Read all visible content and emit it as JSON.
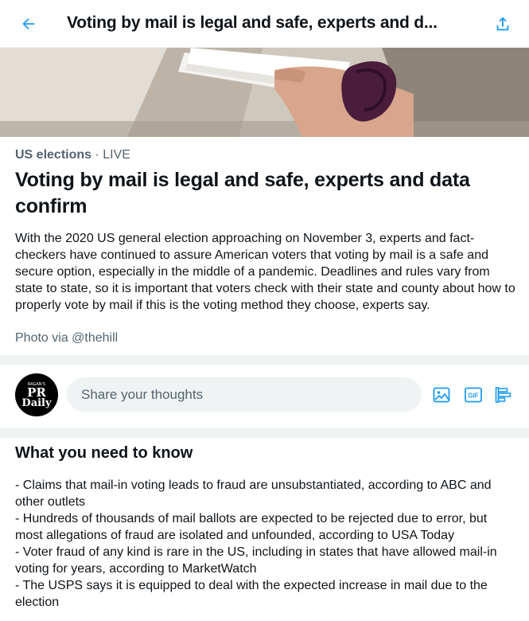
{
  "header": {
    "title": "Voting by mail is legal and safe, experts and d...",
    "back_icon": "arrow-left-icon",
    "share_icon": "share-icon",
    "accent_color": "#1d9bf0"
  },
  "hero": {
    "description": "hand holding mail envelopes"
  },
  "story": {
    "topic": "US elections",
    "separator": "·",
    "status": "LIVE",
    "headline": "Voting by mail is legal and safe, experts and data confirm",
    "summary": "With the 2020 US general election approaching on November 3, experts and fact-checkers have continued to assure American voters that voting by mail is a safe and secure option, especially in the middle of a pandemic. Deadlines and rules vary from state to state, so it is important that voters check with their state and county about how to properly vote by mail if this is the voting method they choose, experts say.",
    "photo_credit": "Photo via @thehill"
  },
  "composer": {
    "avatar": {
      "small_text": "RAGAN'S",
      "line1": "PR",
      "line2": "Daily"
    },
    "placeholder": "Share your thoughts",
    "tools": [
      "image-icon",
      "gif-icon",
      "poll-icon"
    ]
  },
  "need_to_know": {
    "title": "What you need to know",
    "items": [
      "- Claims that mail-in voting leads to fraud are unsubstantiated, according to ABC and other outlets",
      "- Hundreds of thousands of mail ballots are expected to be rejected due to error, but most allegations of fraud are isolated and unfounded, according to USA Today",
      "- Voter fraud of any kind is rare in the US, including in states that have allowed mail-in voting for years, according to MarketWatch",
      "- The USPS says it is equipped to deal with the expected increase in mail due to the election"
    ]
  }
}
